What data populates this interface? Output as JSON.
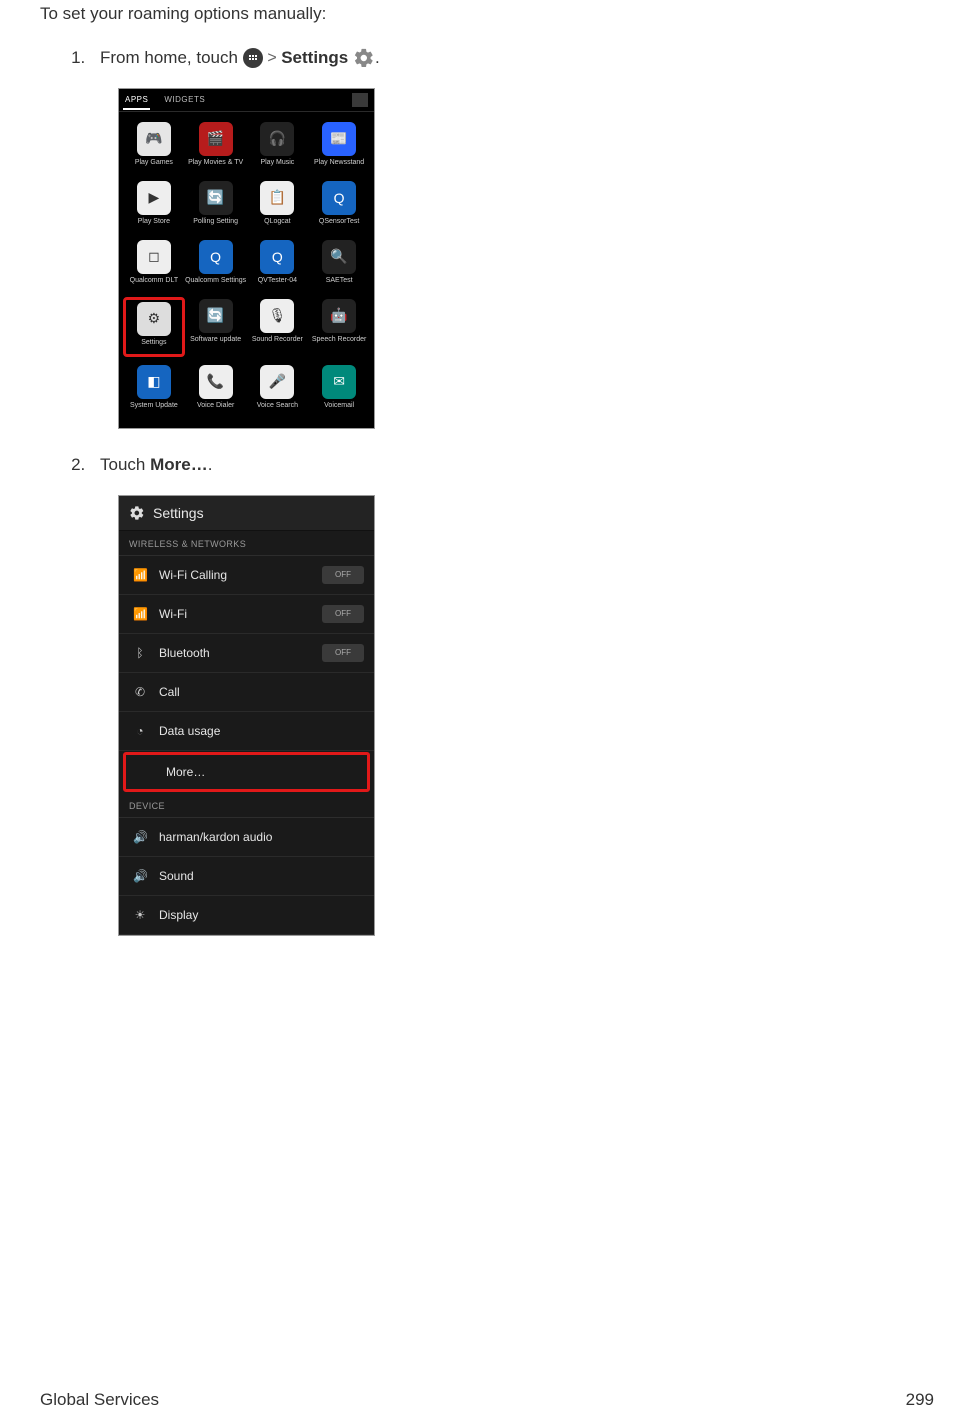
{
  "intro": "To set your roaming options manually:",
  "step1": {
    "prefix": "From home, touch ",
    "sep": " > ",
    "settings": "Settings",
    "suffix": "."
  },
  "step2": {
    "prefix": "Touch ",
    "more": "More…",
    "suffix": "."
  },
  "app_drawer": {
    "tabs": {
      "apps": "APPS",
      "widgets": "WIDGETS"
    },
    "apps": [
      {
        "label": "Play Games",
        "emoji": "🎮",
        "bg": "#e6e6e6"
      },
      {
        "label": "Play Movies & TV",
        "emoji": "🎬",
        "bg": "#b71c1c"
      },
      {
        "label": "Play Music",
        "emoji": "🎧",
        "bg": "#222"
      },
      {
        "label": "Play Newsstand",
        "emoji": "📰",
        "bg": "#2962ff"
      },
      {
        "label": "Play Store",
        "emoji": "▶",
        "bg": "#eee"
      },
      {
        "label": "Polling Setting",
        "emoji": "🔄",
        "bg": "#222"
      },
      {
        "label": "QLogcat",
        "emoji": "📋",
        "bg": "#eee"
      },
      {
        "label": "QSensorTest",
        "emoji": "Q",
        "bg": "#1565c0"
      },
      {
        "label": "Qualcomm DLT",
        "emoji": "◻",
        "bg": "#eee"
      },
      {
        "label": "Qualcomm Settings",
        "emoji": "Q",
        "bg": "#1565c0"
      },
      {
        "label": "QVTester-04",
        "emoji": "Q",
        "bg": "#1565c0"
      },
      {
        "label": "SAETest",
        "emoji": "🔍",
        "bg": "#222"
      },
      {
        "label": "Settings",
        "emoji": "⚙",
        "bg": "#ddd",
        "hl": true
      },
      {
        "label": "Software update",
        "emoji": "🔄",
        "bg": "#222"
      },
      {
        "label": "Sound Recorder",
        "emoji": "🎙",
        "bg": "#eee"
      },
      {
        "label": "Speech Recorder",
        "emoji": "🤖",
        "bg": "#222"
      },
      {
        "label": "System Update",
        "emoji": "◧",
        "bg": "#1565c0"
      },
      {
        "label": "Voice Dialer",
        "emoji": "📞",
        "bg": "#eee"
      },
      {
        "label": "Voice Search",
        "emoji": "🎤",
        "bg": "#eee"
      },
      {
        "label": "Voicemail",
        "emoji": "✉",
        "bg": "#00897b"
      }
    ]
  },
  "settings_screen": {
    "header": "Settings",
    "section1": "WIRELESS & NETWORKS",
    "rows1": [
      {
        "icon": "📶",
        "label": "Wi-Fi Calling",
        "toggle": "OFF"
      },
      {
        "icon": "📶",
        "label": "Wi-Fi",
        "toggle": "OFF"
      },
      {
        "icon": "ᛒ",
        "label": "Bluetooth",
        "toggle": "OFF"
      },
      {
        "icon": "✆",
        "label": "Call"
      },
      {
        "icon": "◔",
        "label": "Data usage"
      }
    ],
    "more": "More…",
    "section2": "DEVICE",
    "rows2": [
      {
        "icon": "🔊",
        "label": "harman/kardon audio"
      },
      {
        "icon": "🔊",
        "label": "Sound"
      },
      {
        "icon": "☀",
        "label": "Display"
      }
    ]
  },
  "footer": {
    "left": "Global Services",
    "right": "299"
  }
}
